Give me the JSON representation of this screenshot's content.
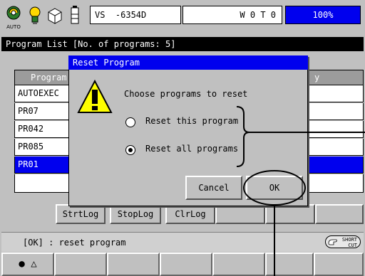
{
  "topbar": {
    "auto_label": "AUTO",
    "status_box_1": "VS  -6354D",
    "status_box_2": "W 0 T 0",
    "speed": "100%"
  },
  "title_bar": {
    "text": "Program List  [No. of programs: 5]"
  },
  "list": {
    "header_left": "Program",
    "header_right": "y",
    "rows": [
      {
        "name": "AUTOEXEC",
        "selected": false
      },
      {
        "name": "PR07",
        "selected": false
      },
      {
        "name": "PR042",
        "selected": false
      },
      {
        "name": "PR085",
        "selected": false
      },
      {
        "name": "PR01",
        "selected": true
      },
      {
        "name": "",
        "selected": false
      }
    ]
  },
  "log_buttons": {
    "strtlog": "StrtLog",
    "stoplog": "StopLog",
    "clrlog": "ClrLog"
  },
  "message_bar": {
    "text": "[OK] : reset program",
    "shortcut_line1": "SHORT",
    "shortcut_line2": "CUT"
  },
  "dialog": {
    "title": "Reset Program",
    "prompt": "Choose programs to reset",
    "options": [
      {
        "label": "Reset this program",
        "selected": false
      },
      {
        "label": "Reset all programs",
        "selected": true
      }
    ],
    "cancel_label": "Cancel",
    "ok_label": "OK"
  },
  "function_keys": {
    "key1_symbols": "●  △"
  },
  "colors": {
    "selection": "#0000ee",
    "background": "#c0c0c0"
  }
}
